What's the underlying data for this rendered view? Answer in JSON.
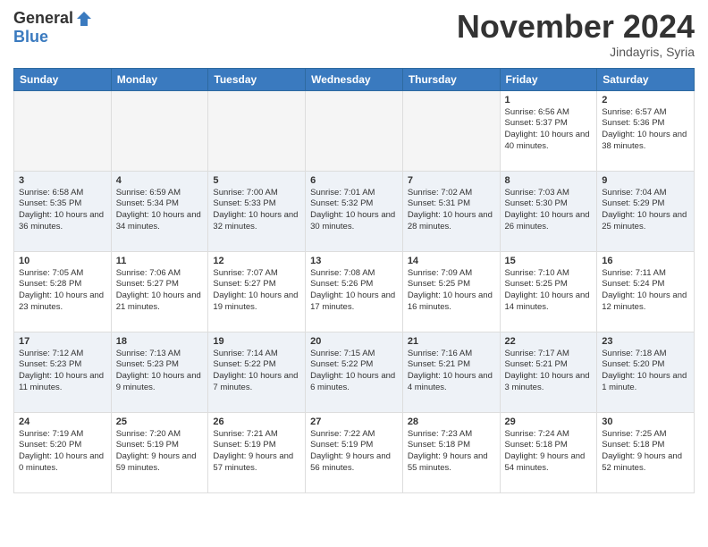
{
  "header": {
    "logo_general": "General",
    "logo_blue": "Blue",
    "month_title": "November 2024",
    "subtitle": "Jindayris, Syria"
  },
  "weekdays": [
    "Sunday",
    "Monday",
    "Tuesday",
    "Wednesday",
    "Thursday",
    "Friday",
    "Saturday"
  ],
  "weeks": [
    [
      {
        "day": "",
        "empty": true
      },
      {
        "day": "",
        "empty": true
      },
      {
        "day": "",
        "empty": true
      },
      {
        "day": "",
        "empty": true
      },
      {
        "day": "",
        "empty": true
      },
      {
        "day": "1",
        "sunrise": "6:56 AM",
        "sunset": "5:37 PM",
        "daylight": "10 hours and 40 minutes."
      },
      {
        "day": "2",
        "sunrise": "6:57 AM",
        "sunset": "5:36 PM",
        "daylight": "10 hours and 38 minutes."
      }
    ],
    [
      {
        "day": "3",
        "sunrise": "6:58 AM",
        "sunset": "5:35 PM",
        "daylight": "10 hours and 36 minutes."
      },
      {
        "day": "4",
        "sunrise": "6:59 AM",
        "sunset": "5:34 PM",
        "daylight": "10 hours and 34 minutes."
      },
      {
        "day": "5",
        "sunrise": "7:00 AM",
        "sunset": "5:33 PM",
        "daylight": "10 hours and 32 minutes."
      },
      {
        "day": "6",
        "sunrise": "7:01 AM",
        "sunset": "5:32 PM",
        "daylight": "10 hours and 30 minutes."
      },
      {
        "day": "7",
        "sunrise": "7:02 AM",
        "sunset": "5:31 PM",
        "daylight": "10 hours and 28 minutes."
      },
      {
        "day": "8",
        "sunrise": "7:03 AM",
        "sunset": "5:30 PM",
        "daylight": "10 hours and 26 minutes."
      },
      {
        "day": "9",
        "sunrise": "7:04 AM",
        "sunset": "5:29 PM",
        "daylight": "10 hours and 25 minutes."
      }
    ],
    [
      {
        "day": "10",
        "sunrise": "7:05 AM",
        "sunset": "5:28 PM",
        "daylight": "10 hours and 23 minutes."
      },
      {
        "day": "11",
        "sunrise": "7:06 AM",
        "sunset": "5:27 PM",
        "daylight": "10 hours and 21 minutes."
      },
      {
        "day": "12",
        "sunrise": "7:07 AM",
        "sunset": "5:27 PM",
        "daylight": "10 hours and 19 minutes."
      },
      {
        "day": "13",
        "sunrise": "7:08 AM",
        "sunset": "5:26 PM",
        "daylight": "10 hours and 17 minutes."
      },
      {
        "day": "14",
        "sunrise": "7:09 AM",
        "sunset": "5:25 PM",
        "daylight": "10 hours and 16 minutes."
      },
      {
        "day": "15",
        "sunrise": "7:10 AM",
        "sunset": "5:25 PM",
        "daylight": "10 hours and 14 minutes."
      },
      {
        "day": "16",
        "sunrise": "7:11 AM",
        "sunset": "5:24 PM",
        "daylight": "10 hours and 12 minutes."
      }
    ],
    [
      {
        "day": "17",
        "sunrise": "7:12 AM",
        "sunset": "5:23 PM",
        "daylight": "10 hours and 11 minutes."
      },
      {
        "day": "18",
        "sunrise": "7:13 AM",
        "sunset": "5:23 PM",
        "daylight": "10 hours and 9 minutes."
      },
      {
        "day": "19",
        "sunrise": "7:14 AM",
        "sunset": "5:22 PM",
        "daylight": "10 hours and 7 minutes."
      },
      {
        "day": "20",
        "sunrise": "7:15 AM",
        "sunset": "5:22 PM",
        "daylight": "10 hours and 6 minutes."
      },
      {
        "day": "21",
        "sunrise": "7:16 AM",
        "sunset": "5:21 PM",
        "daylight": "10 hours and 4 minutes."
      },
      {
        "day": "22",
        "sunrise": "7:17 AM",
        "sunset": "5:21 PM",
        "daylight": "10 hours and 3 minutes."
      },
      {
        "day": "23",
        "sunrise": "7:18 AM",
        "sunset": "5:20 PM",
        "daylight": "10 hours and 1 minute."
      }
    ],
    [
      {
        "day": "24",
        "sunrise": "7:19 AM",
        "sunset": "5:20 PM",
        "daylight": "10 hours and 0 minutes."
      },
      {
        "day": "25",
        "sunrise": "7:20 AM",
        "sunset": "5:19 PM",
        "daylight": "9 hours and 59 minutes."
      },
      {
        "day": "26",
        "sunrise": "7:21 AM",
        "sunset": "5:19 PM",
        "daylight": "9 hours and 57 minutes."
      },
      {
        "day": "27",
        "sunrise": "7:22 AM",
        "sunset": "5:19 PM",
        "daylight": "9 hours and 56 minutes."
      },
      {
        "day": "28",
        "sunrise": "7:23 AM",
        "sunset": "5:18 PM",
        "daylight": "9 hours and 55 minutes."
      },
      {
        "day": "29",
        "sunrise": "7:24 AM",
        "sunset": "5:18 PM",
        "daylight": "9 hours and 54 minutes."
      },
      {
        "day": "30",
        "sunrise": "7:25 AM",
        "sunset": "5:18 PM",
        "daylight": "9 hours and 52 minutes."
      }
    ]
  ]
}
